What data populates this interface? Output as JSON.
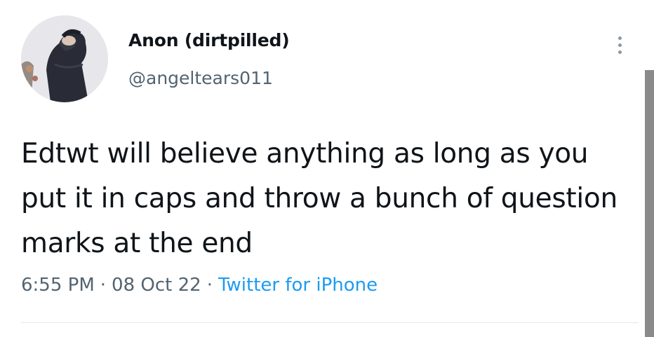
{
  "user": {
    "display_name": "Anon (dirtpilled)",
    "handle": "@angeltears011"
  },
  "tweet": {
    "text": "Edtwt will believe anything as long as you put it in caps and throw a bunch of question marks at the end",
    "time": "6:55 PM",
    "date": "08 Oct 22",
    "source": "Twitter for iPhone",
    "separator": "·"
  },
  "icons": {
    "more": "more-dots-vertical-icon",
    "avatar": "avatar-photo"
  },
  "colors": {
    "text": "#0f1419",
    "secondary": "#536471",
    "link": "#1d9bf0"
  }
}
